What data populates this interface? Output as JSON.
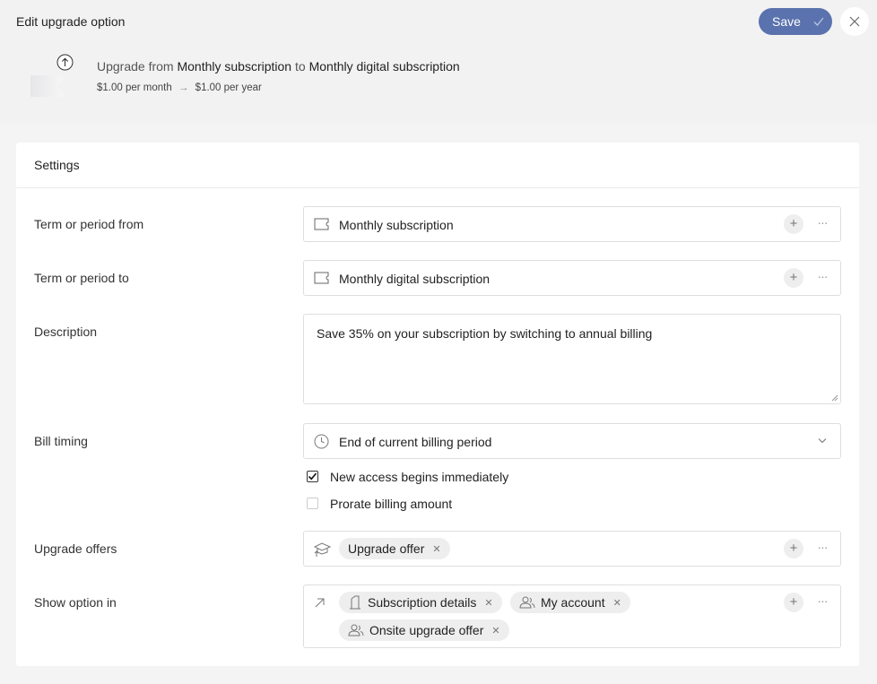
{
  "header": {
    "title": "Edit upgrade option",
    "save_label": "Save",
    "upgrade_prefix": "Upgrade from",
    "from_name": "Monthly subscription",
    "connector": "to",
    "to_name": "Monthly digital subscription",
    "from_price": "$1.00 per month",
    "price_arrow": "→",
    "to_price": "$1.00 per year"
  },
  "settings": {
    "heading": "Settings",
    "term_from": {
      "label": "Term or period from",
      "value": "Monthly subscription"
    },
    "term_to": {
      "label": "Term or period to",
      "value": "Monthly digital subscription"
    },
    "description": {
      "label": "Description",
      "value": "Save 35% on your subscription by switching to annual billing"
    },
    "bill_timing": {
      "label": "Bill timing",
      "value": "End of current billing period"
    },
    "checkboxes": [
      {
        "label": "New access begins immediately",
        "checked": true
      },
      {
        "label": "Prorate billing amount",
        "checked": false
      }
    ],
    "upgrade_offers": {
      "label": "Upgrade offers",
      "chips": [
        "Upgrade offer"
      ]
    },
    "show_option_in": {
      "label": "Show option in",
      "chips": [
        "Subscription details",
        "My account",
        "Onsite upgrade offer"
      ]
    }
  },
  "colors": {
    "accent": "#5a72ad",
    "background": "#f4f4f5",
    "chip": "#eeeeef"
  }
}
